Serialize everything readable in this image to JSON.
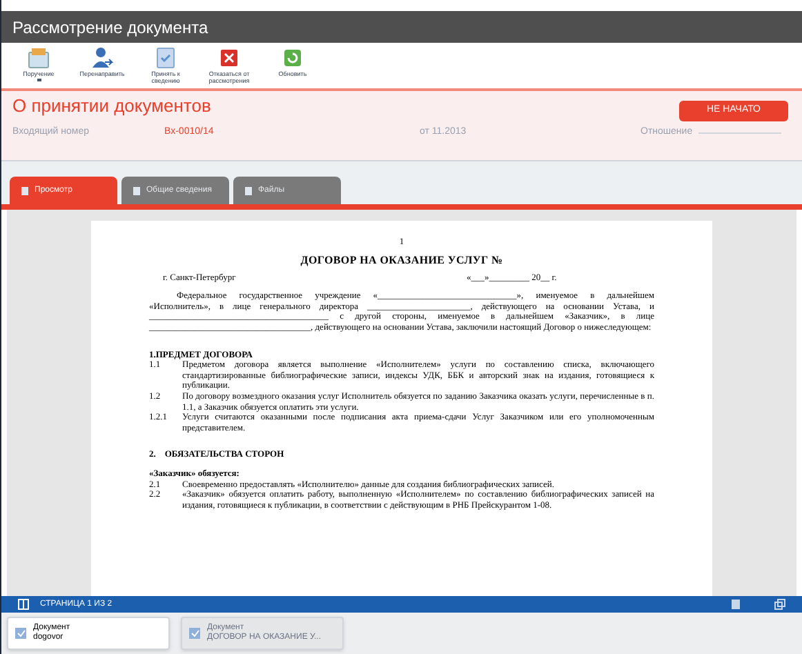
{
  "window": {
    "title": "Рассмотрение документа"
  },
  "toolbar": [
    {
      "label": "Поручение",
      "kind": "assign",
      "has_menu": true
    },
    {
      "label": "Перенаправить",
      "kind": "redirect",
      "has_menu": false
    },
    {
      "label": "Принять к сведению",
      "kind": "accept",
      "has_menu": false
    },
    {
      "label": "Отказаться от рассмотрения",
      "kind": "decline",
      "has_menu": false
    },
    {
      "label": "Обновить",
      "kind": "refresh",
      "has_menu": false
    }
  ],
  "header": {
    "title": "О принятии документов",
    "number_label": "Входящий номер",
    "number": "Вх-0010/14",
    "date": "от 11.2013",
    "status": "НЕ НАЧАТО",
    "field_label": "Отношение"
  },
  "tabs": [
    {
      "label": "Просмотр",
      "selected": true
    },
    {
      "label": "Общие сведения",
      "selected": false
    },
    {
      "label": "Файлы",
      "selected": false
    }
  ],
  "document": {
    "page_number": "1",
    "title": "ДОГОВОР НА ОКАЗАНИЕ УСЛУГ №",
    "city": "г. Санкт-Петербург",
    "date": "«___»_________ 20__ г.",
    "intro": "Федеральное государственное учреждение «_______________________________», именуемое в дальнейшем «Исполнитель», в лице генерального директора _______________________, действующего на основании Устава, и ________________________________________ с другой стороны, именуемое в дальнейшем «Заказчик», в лице ____________________________________, действующего на основании Устава, заключили настоящий Договор о нижеследующем:",
    "sections": [
      {
        "heading": "1.ПРЕДМЕТ ДОГОВОРА",
        "items": [
          {
            "num": "1.1",
            "text": "Предметом договора является выполнение «Исполнителем» услуги по составлению списка, включающего стандартизированные библиографические записи, индексы УДК, ББК и авторский знак на издания, готовящиеся к публикации."
          },
          {
            "num": "1.2",
            "text": "По договору возмездного оказания услуг Исполнитель обязуется по заданию Заказчика оказать услуги, перечисленные в п. 1.1, а Заказчик обязуется оплатить эти услуги."
          },
          {
            "num": "1.2.1",
            "text": "Услуги считаются оказанными после подписания акта приема-сдачи Услуг Заказчиком или его уполномоченным представителем."
          }
        ]
      },
      {
        "heading": "2.    ОБЯЗАТЕЛЬСТВА СТОРОН",
        "subheading": "«Заказчик» обязуется:",
        "items": [
          {
            "num": "2.1",
            "text": "Своевременно предоставлять «Исполнителю» данные для создания библиографических записей."
          },
          {
            "num": "2.2",
            "text": "«Заказчик» обязуется оплатить работу, выполненную «Исполнителем» по составлению библиографических записей на издания, готовящиеся к публикации, в соответствии с действующим в РНБ Прейскурантом 1-08."
          }
        ]
      }
    ]
  },
  "status_bar": {
    "page": "СТРАНИЦА 1 ИЗ 2"
  },
  "taskbar": [
    {
      "caption": "Документ",
      "name": "dogovor",
      "selected": true
    },
    {
      "caption": "Документ",
      "name": "ДОГОВОР НА ОКАЗАНИЕ У...",
      "selected": false
    }
  ]
}
